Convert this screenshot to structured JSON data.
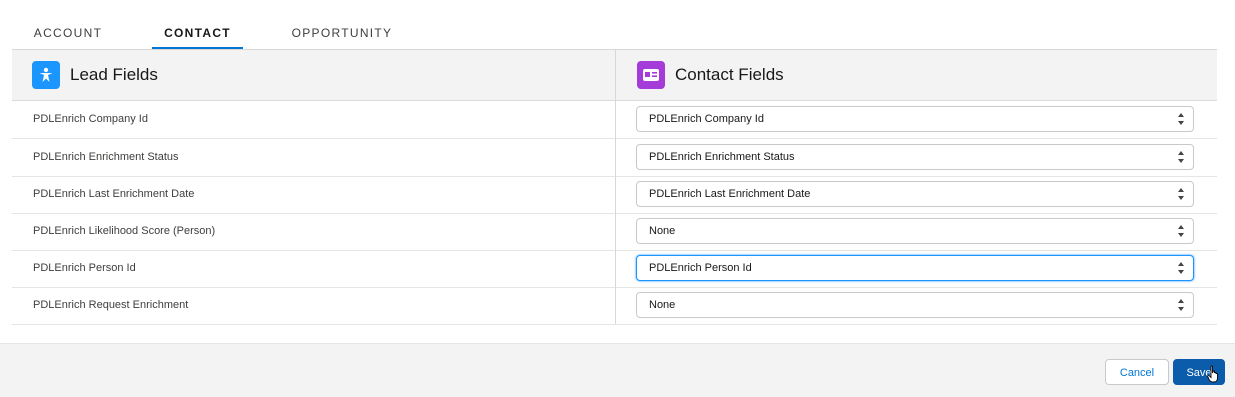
{
  "tabs": [
    {
      "label": "ACCOUNT",
      "active": false
    },
    {
      "label": "CONTACT",
      "active": true
    },
    {
      "label": "OPPORTUNITY",
      "active": false
    }
  ],
  "left_header": {
    "title": "Lead Fields",
    "icon": "lead-person-icon",
    "color": "#1b96ff"
  },
  "right_header": {
    "title": "Contact Fields",
    "icon": "contact-card-icon",
    "color": "#a53bd8"
  },
  "rows": [
    {
      "label": "PDLEnrich Company Id",
      "selected": "PDLEnrich Company Id"
    },
    {
      "label": "PDLEnrich Enrichment Status",
      "selected": "PDLEnrich Enrichment Status"
    },
    {
      "label": "PDLEnrich Last Enrichment Date",
      "selected": "PDLEnrich Last Enrichment Date"
    },
    {
      "label": "PDLEnrich Likelihood Score (Person)",
      "selected": "None"
    },
    {
      "label": "PDLEnrich Person Id",
      "selected": "PDLEnrich Person Id"
    },
    {
      "label": "PDLEnrich Request Enrichment",
      "selected": "None"
    }
  ],
  "footer": {
    "cancel_label": "Cancel",
    "save_label": "Save"
  },
  "colors": {
    "accent": "#0176d3",
    "brand_button": "#0b5cab"
  }
}
